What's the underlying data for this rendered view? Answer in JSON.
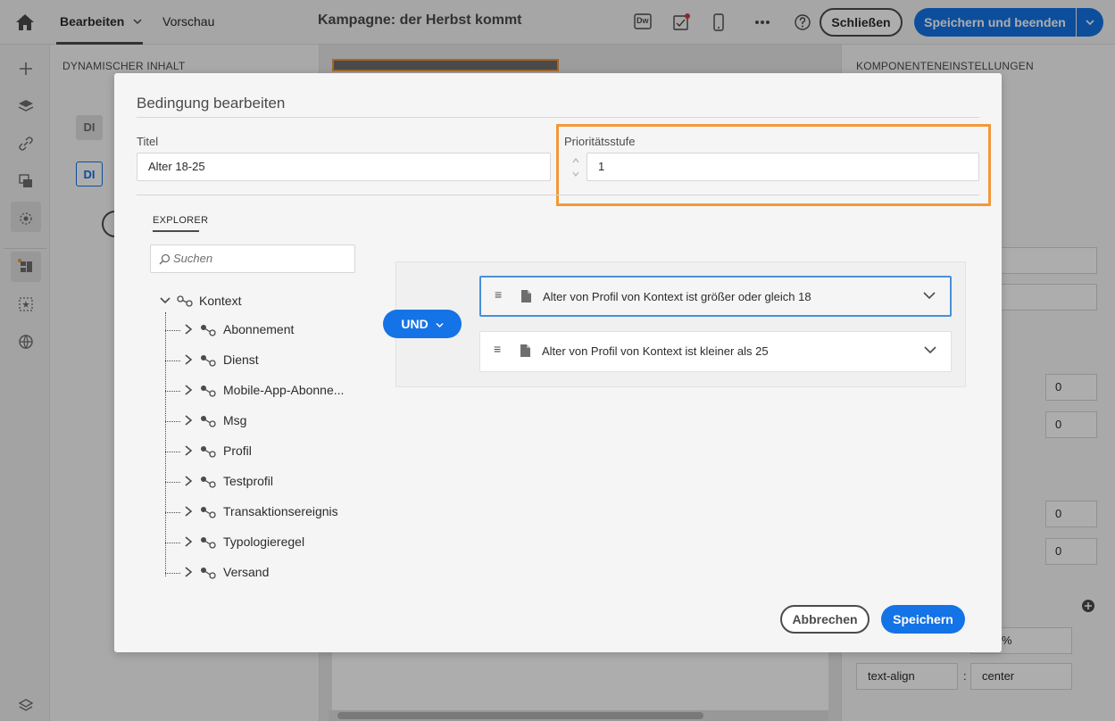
{
  "topbar": {
    "tabs": [
      {
        "label": "Bearbeiten",
        "active": true
      },
      {
        "label": "Vorschau",
        "active": false
      }
    ],
    "campaign_title": "Kampagne: der Herbst kommt",
    "dw_label": "Dw",
    "close_label": "Schließen",
    "save_label": "Speichern und beenden"
  },
  "left_panel": {
    "title": "DYNAMISCHER INHALT",
    "di_label": "DI"
  },
  "right_panel": {
    "title": "KOMPONENTENEINSTELLUNGEN",
    "values": [
      "0",
      "0",
      "0",
      "0"
    ],
    "percent": "%",
    "prop_name": "text-align",
    "prop_sep": ":",
    "prop_value": "center"
  },
  "modal": {
    "title": "Bedingung bearbeiten",
    "title_label": "Titel",
    "title_value": "Alter 18-25",
    "priority_label": "Prioritätsstufe",
    "priority_value": "1",
    "explorer_tab": "EXPLORER",
    "search_placeholder": "Suchen",
    "tree_root": "Kontext",
    "tree_items": [
      "Abonnement",
      "Dienst",
      "Mobile-App-Abonne...",
      "Msg",
      "Profil",
      "Testprofil",
      "Transaktionsereignis",
      "Typologieregel",
      "Versand"
    ],
    "operator": "UND",
    "conditions": [
      {
        "text": "Alter von Profil von Kontext ist größer oder gleich 18",
        "selected": true
      },
      {
        "text": "Alter von Profil von Kontext ist kleiner als 25",
        "selected": false
      }
    ],
    "cancel_label": "Abbrechen",
    "save_label": "Speichern"
  },
  "colors": {
    "accent": "#1473e6",
    "highlight": "#f2993a"
  }
}
